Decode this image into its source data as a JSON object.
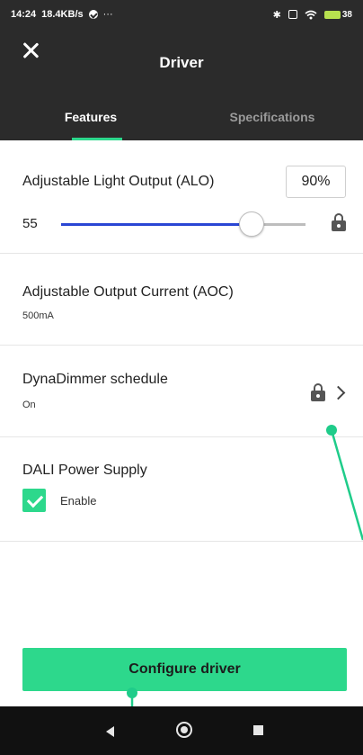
{
  "status_bar": {
    "time": "14:24",
    "speed": "18.4KB/s",
    "more": "···",
    "bluetooth": "✱",
    "battery_pct": "38"
  },
  "app_bar": {
    "title": "Driver"
  },
  "tabs": [
    {
      "label": "Features",
      "active": true
    },
    {
      "label": "Specifications",
      "active": false
    }
  ],
  "alo": {
    "title": "Adjustable Light Output (ALO)",
    "value": "90%",
    "slider_min": "55",
    "slider_fraction": 0.78,
    "locked": true
  },
  "aoc": {
    "title": "Adjustable Output Current (AOC)",
    "value": "500mA"
  },
  "dynadimmer": {
    "title": "DynaDimmer schedule",
    "status": "On",
    "locked": true
  },
  "dali": {
    "title": "DALI Power Supply",
    "checkbox_label": "Enable",
    "checked": true
  },
  "cta": {
    "label": "Configure driver"
  },
  "colors": {
    "accent": "#2dd88c",
    "header": "#2b2b2b",
    "slider": "#2a46d4",
    "annotation": "#1fcc8a"
  }
}
